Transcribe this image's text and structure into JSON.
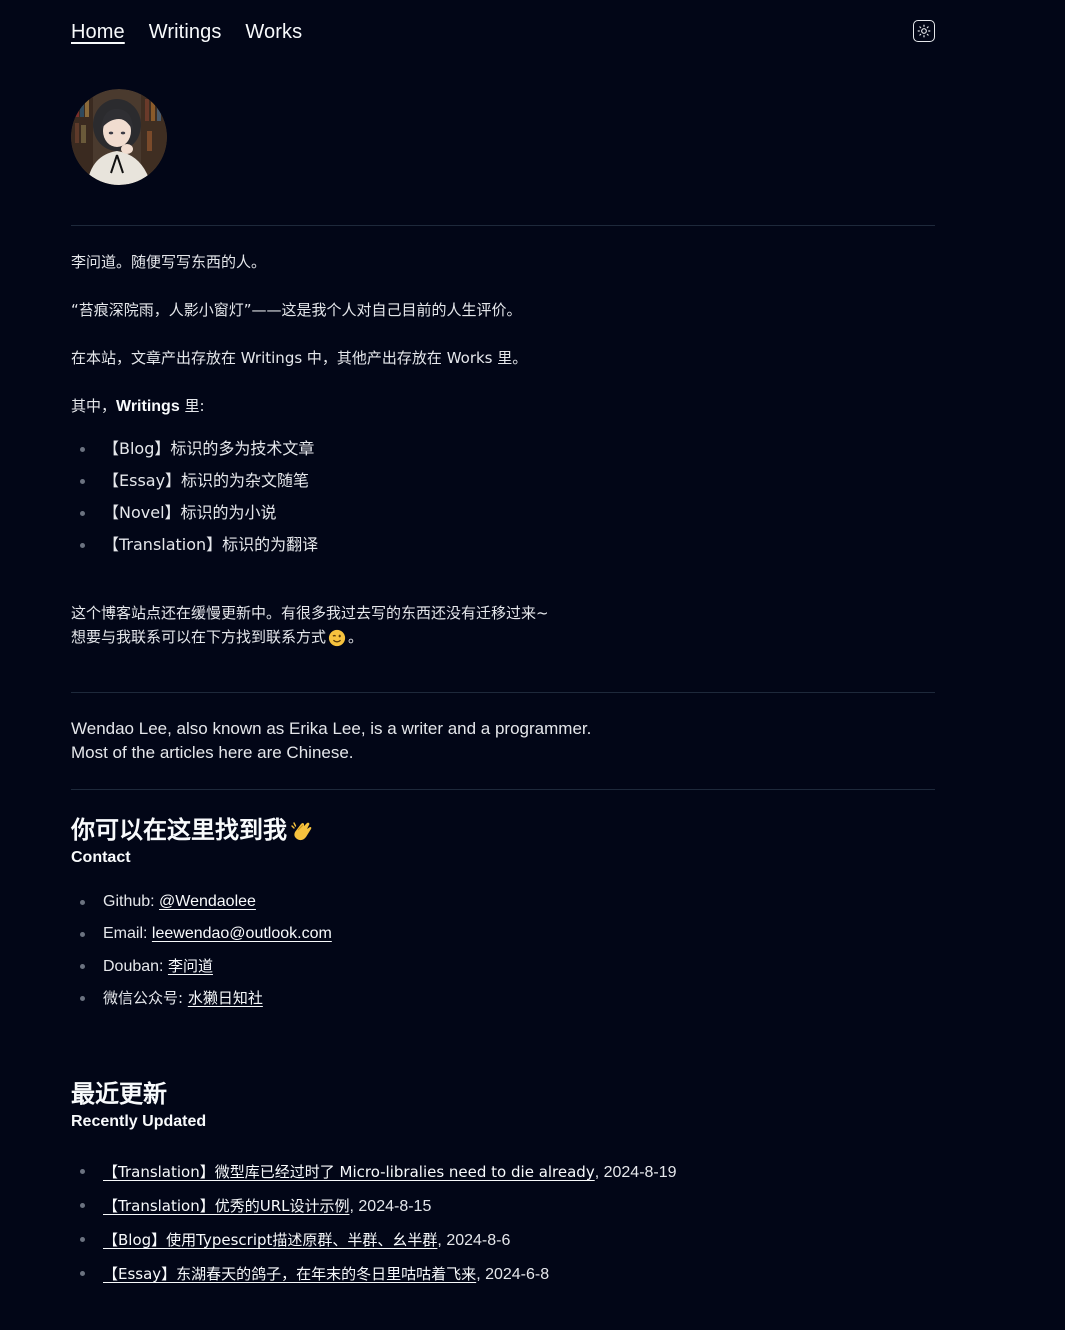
{
  "nav": {
    "items": [
      "Home",
      "Writings",
      "Works"
    ]
  },
  "intro": {
    "line1": "李问道。随便写写东西的人。",
    "line2": "“苔痕深院雨，人影小窗灯”——这是我个人对自己目前的人生评价。",
    "line3": "在本站，文章产出存放在 Writings 中，其他产出存放在 Works 里。",
    "line4_prefix": "其中，",
    "line4_bold": "Writings",
    "line4_suffix": " 里:",
    "tags": [
      "【Blog】标识的多为技术文章",
      "【Essay】标识的为杂文随笔",
      "【Novel】标识的为小说",
      "【Translation】标识的为翻译"
    ],
    "update_line1": "这个博客站点还在缓慢更新中。有很多我过去写的东西还没有迁移过来~",
    "update_line2": "想要与我联系可以在下方找到联系方式",
    "update_line2_end": "。"
  },
  "english": {
    "line1": "Wendao Lee, also known as Erika Lee, is a writer and a programmer.",
    "line2": "Most of the articles here are Chinese."
  },
  "contact": {
    "title": "你可以在这里找到我",
    "subtitle": "Contact",
    "items": [
      {
        "label": "Github: ",
        "value": "@Wendaolee"
      },
      {
        "label": "Email: ",
        "value": "leewendao@outlook.com"
      },
      {
        "label": "Douban: ",
        "value": "李问道"
      },
      {
        "label": "微信公众号: ",
        "value": "水獭日知社"
      }
    ]
  },
  "recent": {
    "title": "最近更新",
    "subtitle": "Recently Updated",
    "items": [
      {
        "title": "【Translation】微型库已经过时了 Micro-libralies need to die already",
        "date": ", 2024-8-19"
      },
      {
        "title": "【Translation】优秀的URL设计示例",
        "date": ", 2024-8-15"
      },
      {
        "title": "【Blog】使用Typescript描述原群、半群、幺半群",
        "date": ", 2024-8-6"
      },
      {
        "title": "【Essay】东湖春天的鸽子，在年末的冬日里咕咕着飞来",
        "date": ", 2024-6-8"
      }
    ]
  },
  "colors": {
    "background": "#020617",
    "text": "#e5e7eb",
    "separator": "#1e293b"
  }
}
